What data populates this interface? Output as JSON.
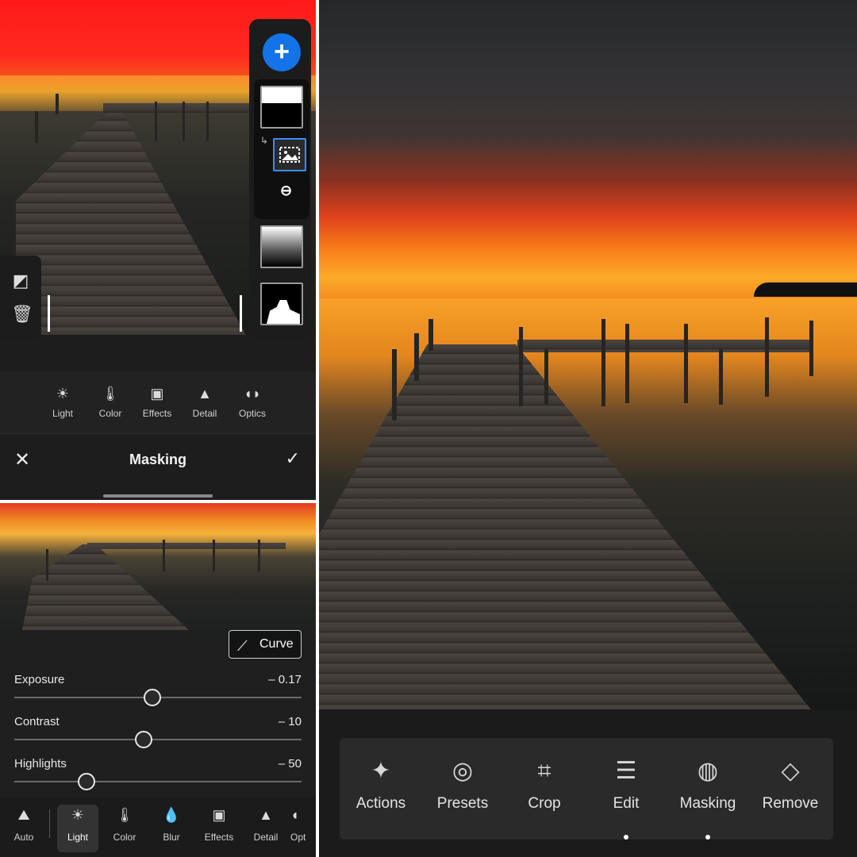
{
  "left_top": {
    "masks": {
      "add_label": "+",
      "subtract_label": "⊖"
    },
    "tabs": [
      {
        "label": "Light",
        "icon": "sun-icon"
      },
      {
        "label": "Color",
        "icon": "thermometer-icon"
      },
      {
        "label": "Effects",
        "icon": "effects-icon"
      },
      {
        "label": "Detail",
        "icon": "detail-icon"
      },
      {
        "label": "Optics",
        "icon": "optics-icon"
      }
    ],
    "masking_bar": {
      "title": "Masking",
      "close": "✕",
      "confirm": "✓"
    }
  },
  "left_bottom": {
    "curve_label": "Curve",
    "adjustments": [
      {
        "label": "Exposure",
        "value": "– 0.17",
        "level": 0.48
      },
      {
        "label": "Contrast",
        "value": "– 10",
        "level": 0.45
      },
      {
        "label": "Highlights",
        "value": "– 50",
        "level": 0.25
      }
    ],
    "tabs": [
      {
        "label": "Auto",
        "icon": "auto-icon"
      },
      {
        "label": "Light",
        "icon": "sun-icon"
      },
      {
        "label": "Color",
        "icon": "thermometer-icon"
      },
      {
        "label": "Blur",
        "icon": "blur-icon"
      },
      {
        "label": "Effects",
        "icon": "effects-icon"
      },
      {
        "label": "Detail",
        "icon": "detail-icon"
      },
      {
        "label": "Opt",
        "icon": "optics-icon"
      }
    ]
  },
  "right": {
    "toolbar": [
      {
        "label": "Actions",
        "icon": "magic-wand-icon"
      },
      {
        "label": "Presets",
        "icon": "presets-icon"
      },
      {
        "label": "Crop",
        "icon": "crop-icon"
      },
      {
        "label": "Edit",
        "icon": "sliders-icon"
      },
      {
        "label": "Masking",
        "icon": "masking-icon"
      },
      {
        "label": "Remove",
        "icon": "eraser-icon"
      }
    ]
  }
}
